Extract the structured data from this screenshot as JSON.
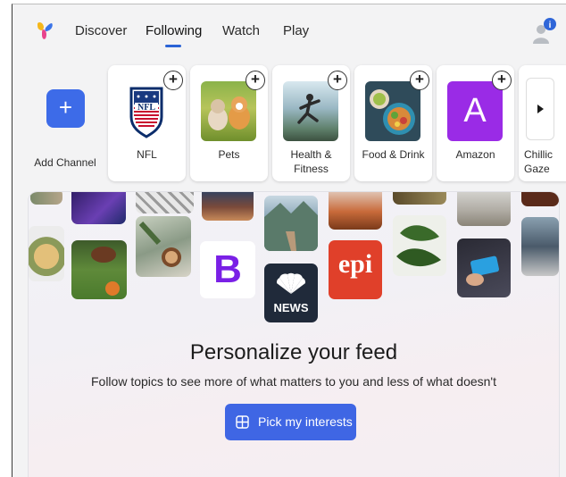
{
  "nav": {
    "tabs": [
      {
        "label": "Discover"
      },
      {
        "label": "Following"
      },
      {
        "label": "Watch"
      },
      {
        "label": "Play"
      }
    ],
    "active_tab": "Following",
    "notification_badge": "i"
  },
  "channels": {
    "add_label": "Add Channel",
    "add_symbol": "+",
    "items": [
      {
        "label": "NFL",
        "icon": "nfl-logo"
      },
      {
        "label": "Pets",
        "icon": "pets-photo"
      },
      {
        "label": "Health &\nFitness",
        "icon": "fitness-photo"
      },
      {
        "label": "Food & Drink",
        "icon": "food-photo"
      },
      {
        "label": "Amazon",
        "icon": "amazon-letter",
        "letter": "A"
      },
      {
        "label": "Chillic\nGaze",
        "icon": "chevron-right-icon"
      }
    ]
  },
  "personalize": {
    "title": "Personalize your feed",
    "subtitle": "Follow topics to see more of what matters to you and less of what doesn't",
    "button_label": "Pick my interests",
    "tiles": {
      "b_letter": "B",
      "news_label": "NEWS",
      "epi_label": "epi"
    }
  },
  "colors": {
    "accent": "#3d6be8",
    "background": "#f3f3f4"
  }
}
